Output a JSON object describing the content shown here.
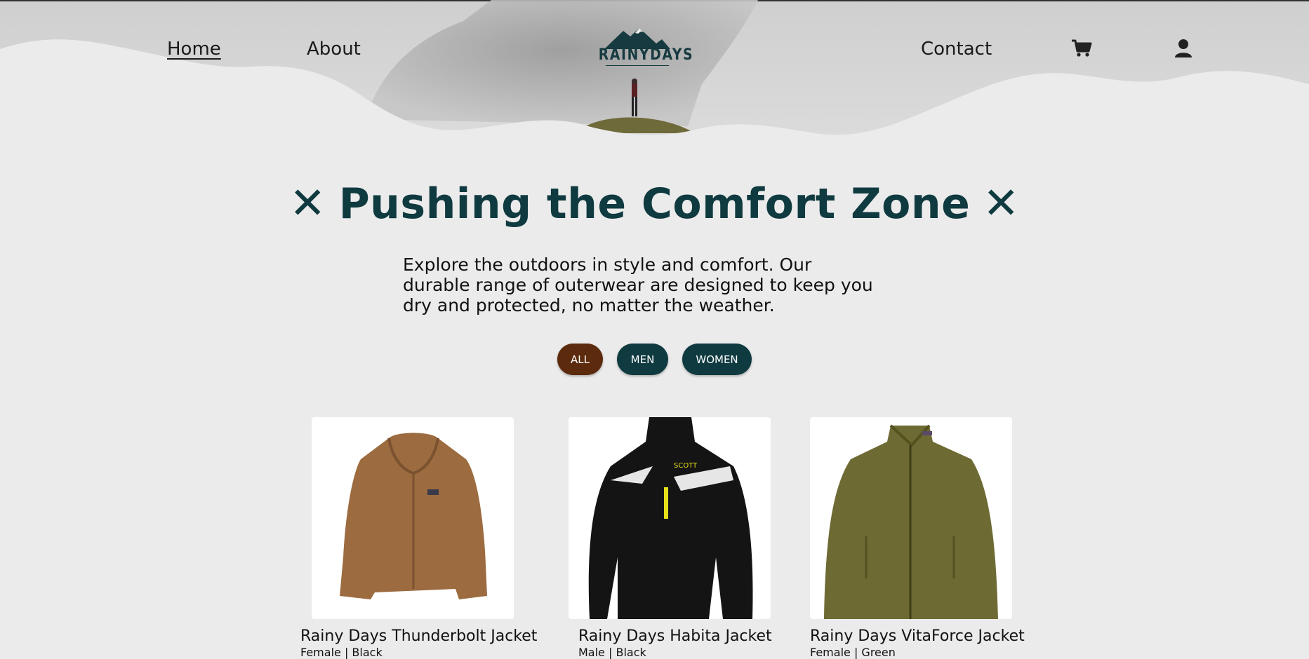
{
  "nav": {
    "home": "Home",
    "about": "About",
    "contact": "Contact",
    "brand": "RAINYDAYS",
    "cart_icon": "cart-icon",
    "user_icon": "user-icon"
  },
  "hero": {
    "headline": "Pushing the Comfort Zone",
    "decor_icon": "cross-icon",
    "intro": "Explore the outdoors in style and comfort. Our durable range of outerwear are designed to keep you dry and protected, no matter the weather."
  },
  "filters": [
    {
      "label": "ALL",
      "active": true,
      "color": "#5c2a0c"
    },
    {
      "label": "MEN",
      "active": false,
      "color": "#0f3a40"
    },
    {
      "label": "WOMEN",
      "active": false,
      "color": "#0f3a40"
    }
  ],
  "products": [
    {
      "title": "Rainy Days Thunderbolt Jacket",
      "subtitle": "Female | Black",
      "color": "#9c6b3f"
    },
    {
      "title": "Rainy Days Habita Jacket",
      "subtitle": "Male | Black",
      "color": "#141414"
    },
    {
      "title": "Rainy Days VitaForce Jacket",
      "subtitle": "Female | Green",
      "color": "#6e6a34"
    }
  ],
  "colors": {
    "background": "#ebebeb",
    "primary": "#0f3a40",
    "accent": "#5c2a0c"
  }
}
